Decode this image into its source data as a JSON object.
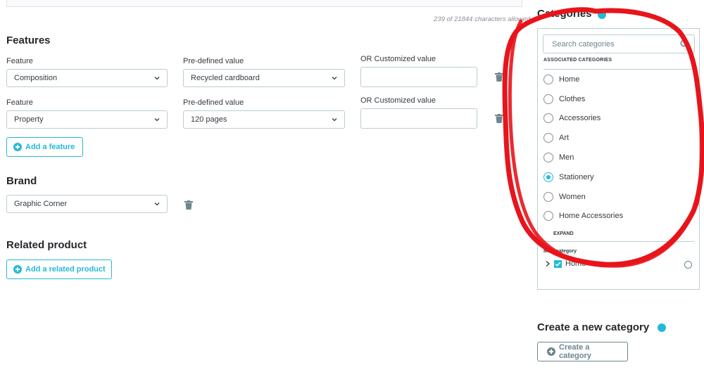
{
  "description": {
    "char_count": "239 of 21844 characters allowed"
  },
  "features": {
    "title": "Features",
    "feature_label": "Feature",
    "predefined_label": "Pre-defined value",
    "custom_label": "OR Customized value",
    "rows": [
      {
        "feature": "Composition",
        "predefined": "Recycled cardboard",
        "custom": ""
      },
      {
        "feature": "Property",
        "predefined": "120 pages",
        "custom": ""
      }
    ],
    "add_label": "Add a feature"
  },
  "brand": {
    "title": "Brand",
    "value": "Graphic Corner"
  },
  "related": {
    "title": "Related product",
    "add_label": "Add a related product"
  },
  "categories": {
    "title": "Categories",
    "search_placeholder": "Search categories",
    "associated_label": "ASSOCIATED CATEGORIES",
    "items": [
      {
        "label": "Home",
        "selected": false
      },
      {
        "label": "Clothes",
        "selected": false
      },
      {
        "label": "Accessories",
        "selected": false
      },
      {
        "label": "Art",
        "selected": false
      },
      {
        "label": "Men",
        "selected": false
      },
      {
        "label": "Stationery",
        "selected": true
      },
      {
        "label": "Women",
        "selected": false
      },
      {
        "label": "Home Accessories",
        "selected": false
      }
    ],
    "expand_label": "EXPAND",
    "main_category_label": "Main category",
    "tree_item": "Home"
  },
  "new_category": {
    "title": "Create a new category",
    "button_label": "Create a category"
  },
  "colors": {
    "accent": "#25b9d7",
    "annotation": "#e8141b",
    "border": "#bbcdd2",
    "muted": "#6c868e"
  }
}
